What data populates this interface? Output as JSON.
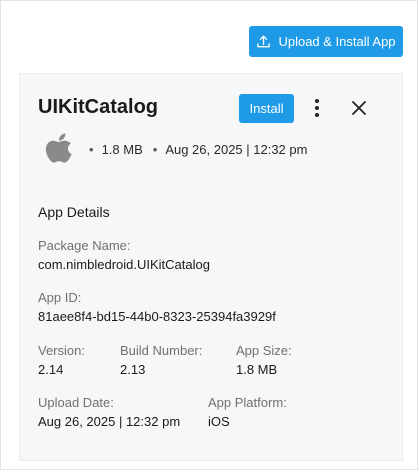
{
  "header": {
    "upload_button_label": "Upload & Install App",
    "upload_icon": "upload-icon"
  },
  "app": {
    "name": "UIKitCatalog",
    "install_label": "Install",
    "platform_icon": "apple-icon",
    "size": "1.8 MB",
    "uploaded": "Aug 26, 2025 | 12:32 pm"
  },
  "details": {
    "section_title": "App Details",
    "package_name_label": "Package Name:",
    "package_name": "com.nimbledroid.UIKitCatalog",
    "app_id_label": "App ID:",
    "app_id": "81aee8f4-bd15-44b0-8323-25394fa3929f",
    "version_label": "Version:",
    "version": "2.14",
    "build_label": "Build Number:",
    "build": "2.13",
    "app_size_label": "App Size:",
    "app_size": "1.8 MB",
    "upload_date_label": "Upload Date:",
    "upload_date": "Aug 26, 2025 | 12:32 pm",
    "platform_label": "App Platform:",
    "platform": "iOS"
  },
  "colors": {
    "accent": "#1e9ae6",
    "panel_bg": "#f6f7f8",
    "label_gray": "#707070"
  }
}
